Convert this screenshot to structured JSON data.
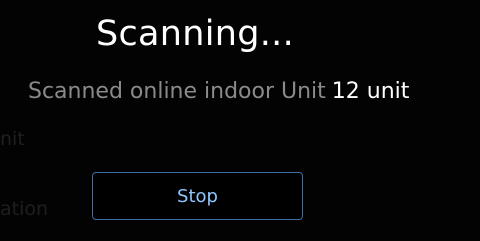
{
  "dialog": {
    "title": "Scanning...",
    "scan_label": "Scanned online indoor Unit",
    "scan_count": "12 unit",
    "stop_label": "Stop"
  },
  "background_fragments": {
    "left_upper": "nit",
    "left_lower": "ation"
  },
  "colors": {
    "background": "#000000",
    "title": "#ffffff",
    "label": "#8a8a8a",
    "count": "#ffffff",
    "button_border": "#3d6fa8",
    "button_text": "#8ec6ff"
  }
}
